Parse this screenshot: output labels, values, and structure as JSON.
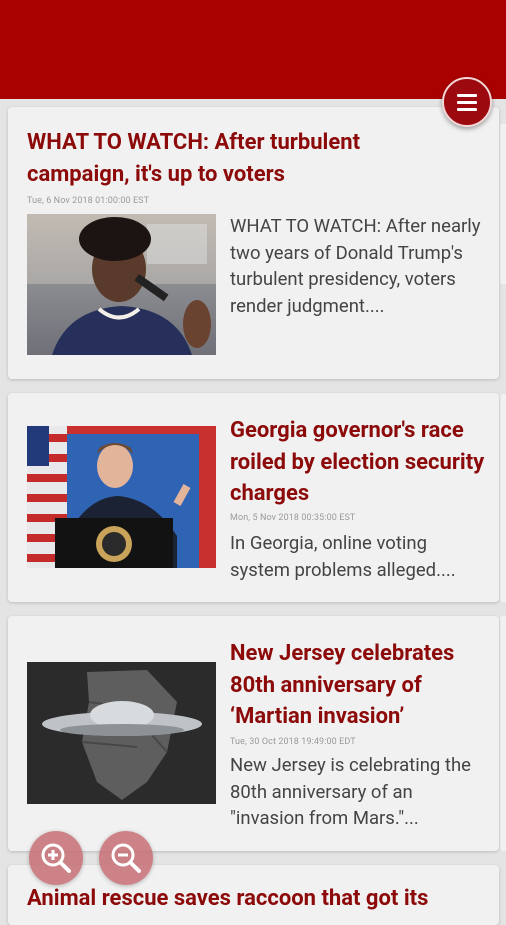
{
  "header": {
    "menu_icon": "hamburger-menu-icon",
    "color": "#a90000"
  },
  "articles": [
    {
      "title": "WHAT TO WATCH: After turbulent campaign, it's up to voters",
      "date": "Tue, 6 Nov 2018 01:00:00 EST",
      "summary": "WHAT TO WATCH: After nearly two years of Donald Trump's turbulent presidency, voters render judgment...."
    },
    {
      "title": "Georgia governor's race roiled by election security charges",
      "date": "Mon, 5 Nov 2018 00:35:00 EST",
      "summary": "In Georgia, online voting system problems alleged...."
    },
    {
      "title": "New Jersey celebrates 80th anniversary of ‘Martian invasion’",
      "date": "Tue, 30 Oct 2018 19:49:00 EDT",
      "summary": "New Jersey is celebrating the 80th anniversary of an \"invasion from Mars.\"..."
    },
    {
      "title": "Animal rescue saves raccoon that got its"
    }
  ],
  "zoom": {
    "zoom_in_icon": "zoom-in-icon",
    "zoom_out_icon": "zoom-out-icon"
  }
}
